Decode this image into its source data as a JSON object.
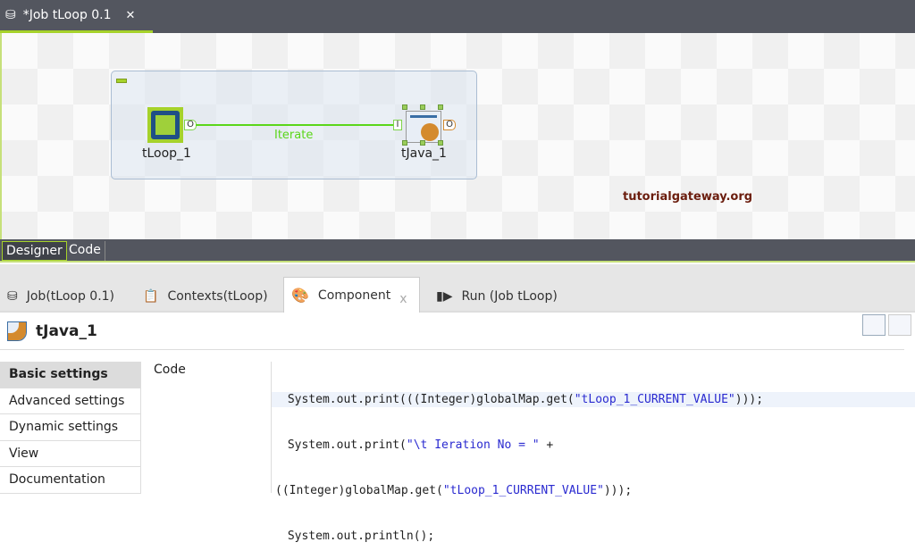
{
  "editor_tab": {
    "title": "*Job tLoop 0.1",
    "close": "✕"
  },
  "canvas": {
    "link_label": "Iterate",
    "components": [
      {
        "name": "tLoop_1",
        "port": "O"
      },
      {
        "name": "tJava_1",
        "in_port": "I",
        "out_port": "O"
      }
    ],
    "watermark": "tutorialgateway.org"
  },
  "view_tabs": [
    "Designer",
    "Code"
  ],
  "panel_tabs": [
    {
      "label": "Job(tLoop 0.1)"
    },
    {
      "label": "Contexts(tLoop)"
    },
    {
      "label": "Component",
      "close": "x"
    },
    {
      "label": "Run (Job tLoop)"
    }
  ],
  "component": {
    "title": "tJava_1"
  },
  "sidebar": [
    "Basic settings",
    "Advanced settings",
    "Dynamic settings",
    "View",
    "Documentation"
  ],
  "code": {
    "label": "Code",
    "lines": [
      [
        " System.out.print(((Integer)globalMap.get(",
        "\"tLoop_1_CURRENT_VALUE\"",
        ")));"
      ],
      [
        " System.out.print(",
        "\"\\t Ieration No = \"",
        " +"
      ],
      [
        "((Integer)globalMap.get(",
        "\"tLoop_1_CURRENT_VALUE\"",
        ")));"
      ],
      [
        " System.out.println();",
        "",
        ""
      ]
    ]
  }
}
